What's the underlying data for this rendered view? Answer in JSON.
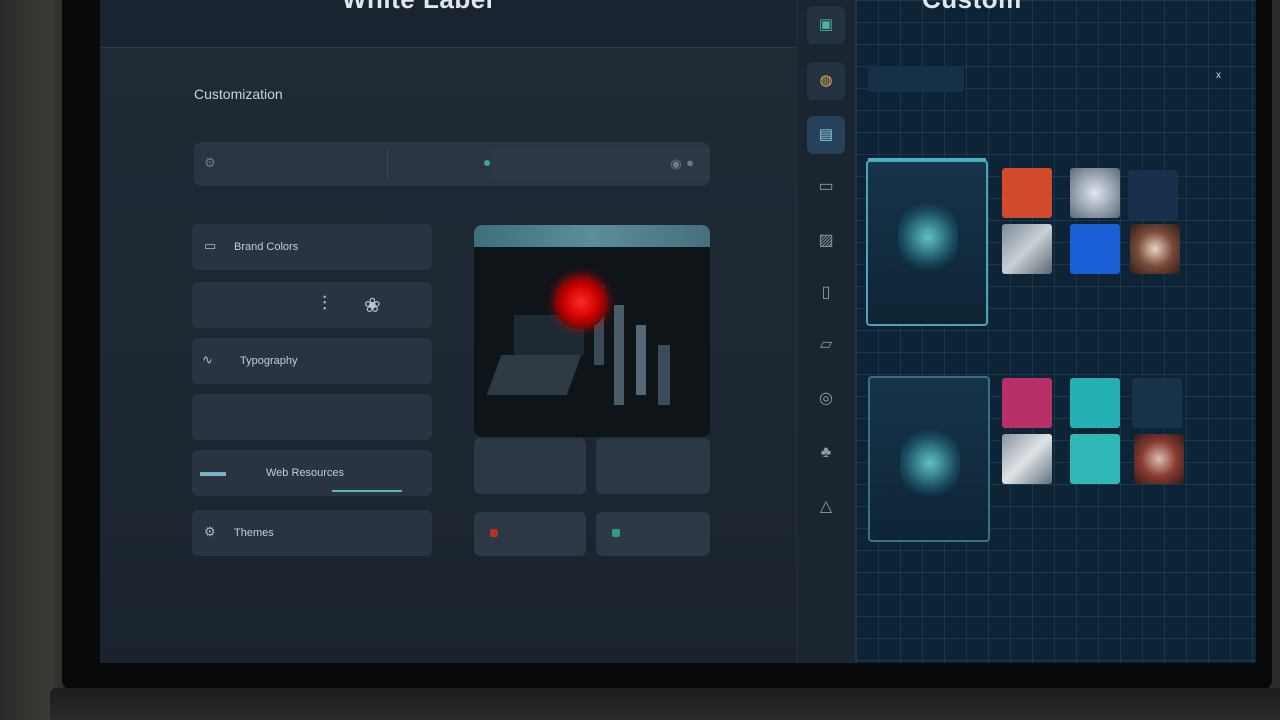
{
  "window": {
    "left_title": "White Label",
    "right_title": "Custom"
  },
  "left_panel": {
    "section_title": "Customization",
    "section_subtitle": "",
    "search": {
      "left_text": "",
      "right_text": ""
    },
    "menu_items": [
      {
        "label": "Brand Colors",
        "icon": "palette-icon"
      },
      {
        "label": "",
        "icon": ""
      },
      {
        "label": "Typography",
        "icon": "waveform-icon"
      },
      {
        "label": "",
        "icon": ""
      },
      {
        "label": "Web Resources",
        "icon": "bars-icon"
      },
      {
        "label": "Themes",
        "icon": "gear-icon"
      }
    ],
    "cards": {
      "card_a_label": "",
      "card_b_label": "",
      "btn_a_label": "",
      "btn_b_label": ""
    }
  },
  "right_panel": {
    "toolbar_label": "",
    "close_label": "x",
    "tick_labels": "",
    "captions": {
      "preview_1": "",
      "preview_2": "",
      "row1_a": "",
      "row1_b": "",
      "row2_a": "",
      "row2_b": "",
      "row2_c": ""
    }
  },
  "colors": {
    "accent_teal": "#43b3c6",
    "seal_red": "#e01919",
    "tile_orange": "#d24a2c",
    "tile_blue": "#1a5fd6",
    "tile_magenta": "#b73066",
    "tile_cyan": "#25b1b3"
  }
}
